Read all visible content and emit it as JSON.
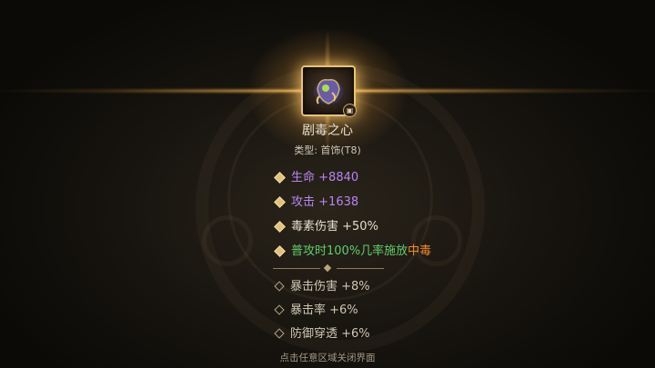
{
  "item": {
    "name": "剧毒之心",
    "type_line": "类型: 首饰(T8)",
    "icon": "poison-heart-icon",
    "locked_icon": "lock-icon"
  },
  "stats": {
    "hp": {
      "label": "生命",
      "value": "+8840"
    },
    "atk": {
      "label": "攻击",
      "value": "+1638"
    },
    "poison_dmg": "毒素伤害 +50%",
    "effect_prefix": "普攻时100%几率施放",
    "effect_keyword": "中毒"
  },
  "sub_stats": {
    "crit_dmg": "暴击伤害 +8%",
    "crit_rate": "暴击率 +6%",
    "def_pen": "防御穿透 +6%"
  },
  "hint": "点击任意区域关闭界面",
  "colors": {
    "purple": "#b685f3",
    "green": "#5fce6a",
    "orange": "#f28a2a",
    "gold": "#e2c27a"
  }
}
